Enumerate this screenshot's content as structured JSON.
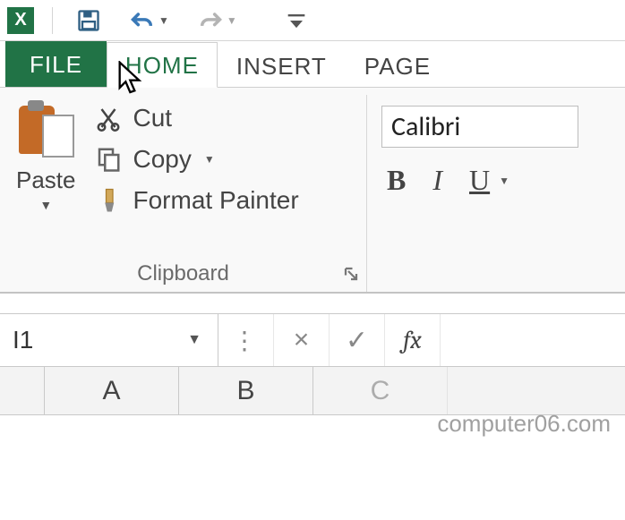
{
  "tabs": {
    "file": "FILE",
    "home": "HOME",
    "insert": "INSERT",
    "page": "PAGE"
  },
  "clipboard": {
    "paste_label": "Paste",
    "cut_label": "Cut",
    "copy_label": "Copy",
    "format_painter_label": "Format Painter",
    "group_title": "Clipboard"
  },
  "font": {
    "name": "Calibri",
    "bold_label": "B",
    "italic_label": "I",
    "underline_label": "U"
  },
  "formula_bar": {
    "cell_reference": "I1",
    "fx_label": "fx",
    "cancel_glyph": "×",
    "enter_glyph": "✓"
  },
  "columns": [
    "A",
    "B",
    "C"
  ],
  "watermark": "computer06.com"
}
